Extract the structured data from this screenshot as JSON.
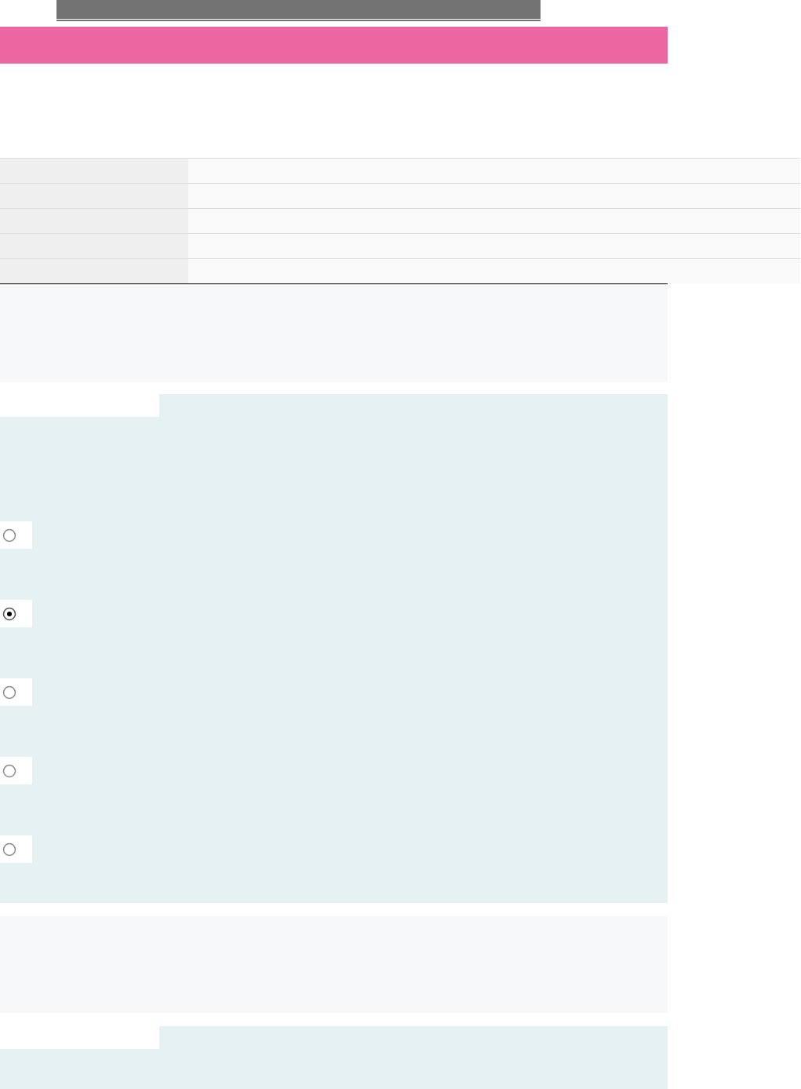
{
  "questions": [
    {
      "options": [
        {
          "selected": false
        },
        {
          "selected": true
        },
        {
          "selected": false
        },
        {
          "selected": false
        },
        {
          "selected": false
        }
      ]
    }
  ]
}
